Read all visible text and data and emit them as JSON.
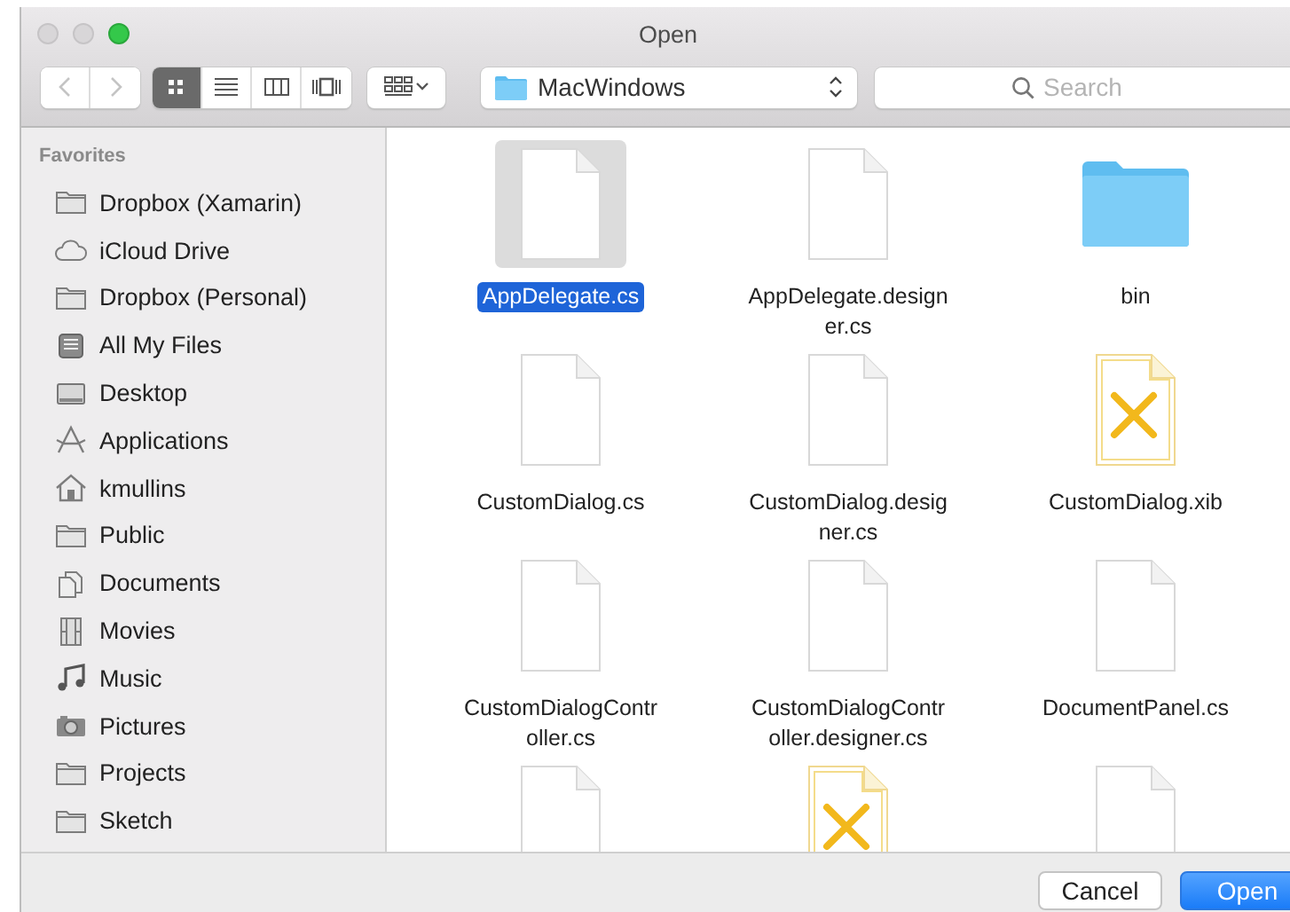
{
  "window": {
    "title": "Open"
  },
  "toolbar": {
    "nav": [
      {
        "kind": "back",
        "disabled": true
      },
      {
        "kind": "forward",
        "disabled": true
      }
    ],
    "view_modes": [
      {
        "kind": "icons",
        "selected": true
      },
      {
        "kind": "list",
        "selected": false
      },
      {
        "kind": "columns",
        "selected": false
      },
      {
        "kind": "cover-flow",
        "selected": false
      }
    ],
    "location": {
      "label": "MacWindows"
    },
    "search": {
      "placeholder": "Search"
    }
  },
  "sidebar": {
    "heading": "Favorites",
    "items": [
      {
        "label": "Dropbox (Xamarin)",
        "kind": "folder"
      },
      {
        "label": "iCloud Drive",
        "kind": "cloud"
      },
      {
        "label": "Dropbox (Personal)",
        "kind": "folder"
      },
      {
        "label": "All My Files",
        "kind": "all-files"
      },
      {
        "label": "Desktop",
        "kind": "desktop"
      },
      {
        "label": "Applications",
        "kind": "applications"
      },
      {
        "label": "kmullins",
        "kind": "home"
      },
      {
        "label": "Public",
        "kind": "folder"
      },
      {
        "label": "Documents",
        "kind": "documents"
      },
      {
        "label": "Movies",
        "kind": "movies"
      },
      {
        "label": "Music",
        "kind": "music"
      },
      {
        "label": "Pictures",
        "kind": "camera"
      },
      {
        "label": "Projects",
        "kind": "folder"
      },
      {
        "label": "Sketch",
        "kind": "folder"
      }
    ]
  },
  "files": [
    {
      "name": "AppDelegate.cs",
      "kind": "document",
      "selected": true
    },
    {
      "name": "AppDelegate.designer.cs",
      "kind": "document",
      "selected": false
    },
    {
      "name": "bin",
      "kind": "folder",
      "selected": false
    },
    {
      "name": "CustomDialog.cs",
      "kind": "document",
      "selected": false
    },
    {
      "name": "CustomDialog.designer.cs",
      "kind": "document",
      "selected": false
    },
    {
      "name": "CustomDialog.xib",
      "kind": "xib",
      "selected": false
    },
    {
      "name": "CustomDialogController.cs",
      "kind": "document",
      "selected": false
    },
    {
      "name": "CustomDialogController.designer.cs",
      "kind": "document",
      "selected": false
    },
    {
      "name": "DocumentPanel.cs",
      "kind": "document",
      "selected": false
    },
    {
      "kind": "document",
      "selected": false
    },
    {
      "kind": "xib",
      "selected": false
    },
    {
      "kind": "document",
      "selected": false
    }
  ],
  "buttons": [
    {
      "label": "Cancel",
      "kind": "secondary"
    },
    {
      "label": "Open",
      "kind": "primary"
    }
  ]
}
